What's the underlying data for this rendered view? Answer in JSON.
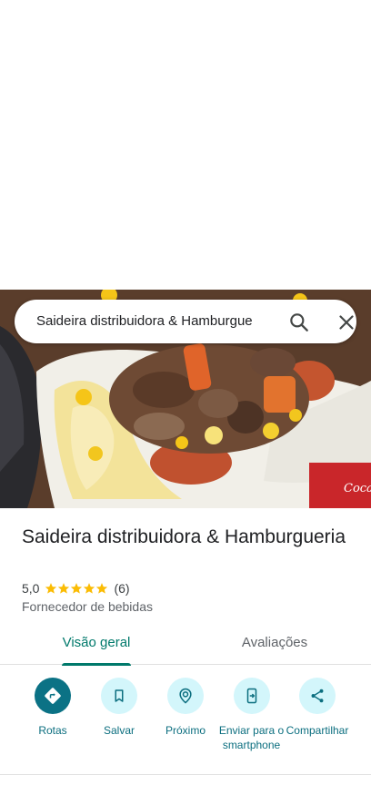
{
  "search": {
    "query": "Saideira distribuidora & Hamburgue"
  },
  "place": {
    "name": "Saideira distribuidora & Hamburgueria",
    "rating": "5,0",
    "stars": 5,
    "review_count": "(6)",
    "category": "Fornecedor de bebidas"
  },
  "tabs": [
    {
      "label": "Visão geral",
      "active": true
    },
    {
      "label": "Avaliações",
      "active": false
    }
  ],
  "actions": [
    {
      "label": "Rotas",
      "icon": "directions-icon"
    },
    {
      "label": "Salvar",
      "icon": "bookmark-icon"
    },
    {
      "label": "Próximo",
      "icon": "nearby-icon"
    },
    {
      "label": "Enviar para o smartphone",
      "icon": "send-to-phone-icon"
    },
    {
      "label": "Compartilhar",
      "icon": "share-icon"
    }
  ],
  "colors": {
    "accent": "#00796b",
    "action_primary": "#0b7285",
    "action_bg": "#d3f6fb",
    "star": "#fbbc04"
  }
}
